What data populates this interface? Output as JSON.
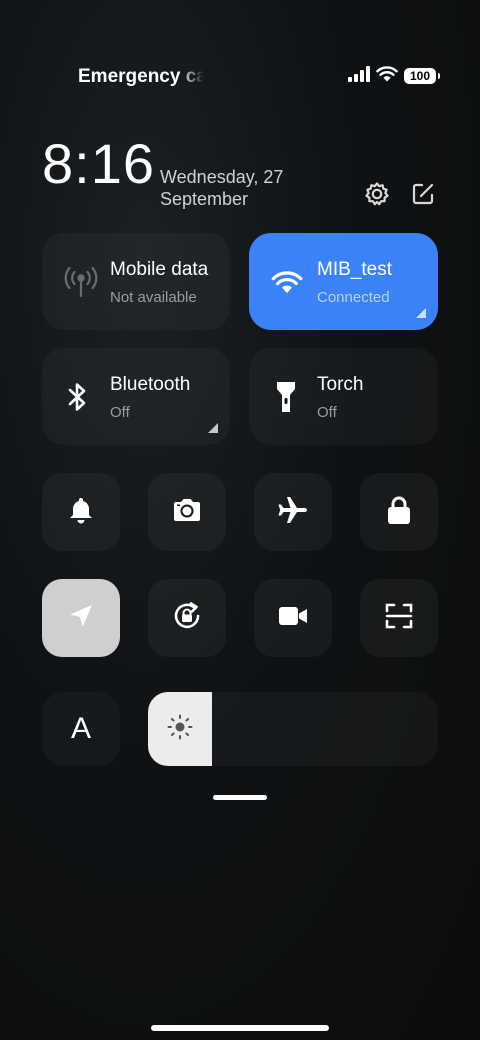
{
  "status_bar": {
    "carrier": "Emergency calls only",
    "battery": "100",
    "icons": [
      "signal-icon",
      "wifi-icon",
      "battery-icon"
    ]
  },
  "header": {
    "time": "8:16",
    "date_line1": "Wednesday, 27",
    "date_line2": "September",
    "settings_icon": "gear-icon",
    "edit_icon": "edit-icon"
  },
  "tiles": {
    "mobile_data": {
      "title": "Mobile data",
      "subtitle": "Not available",
      "icon": "antenna-icon"
    },
    "wifi": {
      "title": "MIB_test",
      "subtitle": "Connected",
      "icon": "wifi-icon",
      "color": "#3b82f6"
    },
    "bluetooth": {
      "title": "Bluetooth",
      "subtitle": "Off",
      "icon": "bluetooth-icon"
    },
    "torch": {
      "title": "Torch",
      "subtitle": "Off",
      "icon": "torch-icon"
    }
  },
  "toggles_row1": [
    "bell-icon",
    "camera-icon",
    "airplane-icon",
    "lock-icon"
  ],
  "toggles_row2": [
    "location-icon",
    "rotation-lock-icon",
    "video-icon",
    "scan-icon"
  ],
  "font_toggle": {
    "label": "A"
  },
  "brightness": {
    "icon": "sun-icon",
    "level": 0.22
  }
}
